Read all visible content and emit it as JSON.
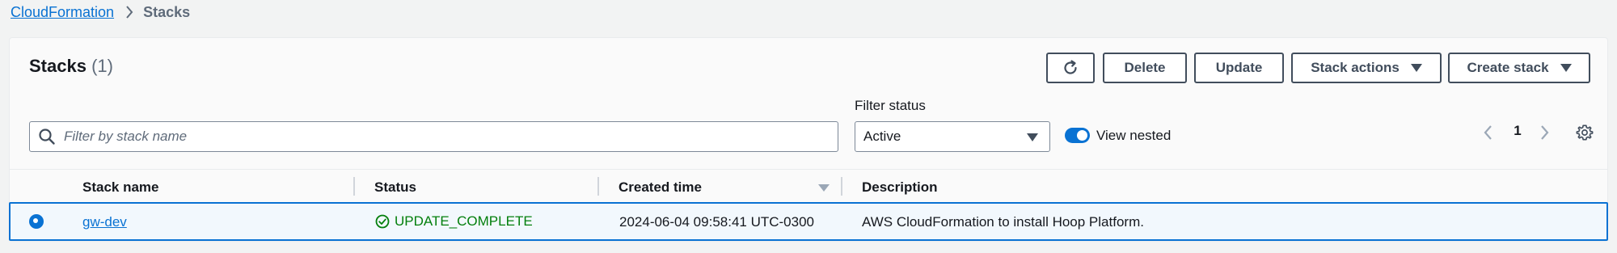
{
  "breadcrumb": {
    "root": "CloudFormation",
    "current": "Stacks"
  },
  "header": {
    "title": "Stacks",
    "count": "(1)"
  },
  "toolbar": {
    "delete_label": "Delete",
    "update_label": "Update",
    "stack_actions_label": "Stack actions",
    "create_stack_label": "Create stack"
  },
  "search": {
    "placeholder": "Filter by stack name",
    "value": ""
  },
  "filter": {
    "label": "Filter status",
    "selected": "Active"
  },
  "view_nested": {
    "label": "View nested",
    "enabled": true
  },
  "pagination": {
    "current_page": "1"
  },
  "table": {
    "columns": [
      "Stack name",
      "Status",
      "Created time",
      "Description"
    ],
    "rows": [
      {
        "selected": true,
        "stack_name": "gw-dev",
        "status": "UPDATE_COMPLETE",
        "created_time": "2024-06-04 09:58:41 UTC-0300",
        "description": "AWS CloudFormation to install Hoop Platform."
      }
    ]
  },
  "colors": {
    "link": "#0972d3",
    "success": "#037f0c",
    "button_border": "#414d5c",
    "selected_row_bg": "#f2f8fd"
  }
}
